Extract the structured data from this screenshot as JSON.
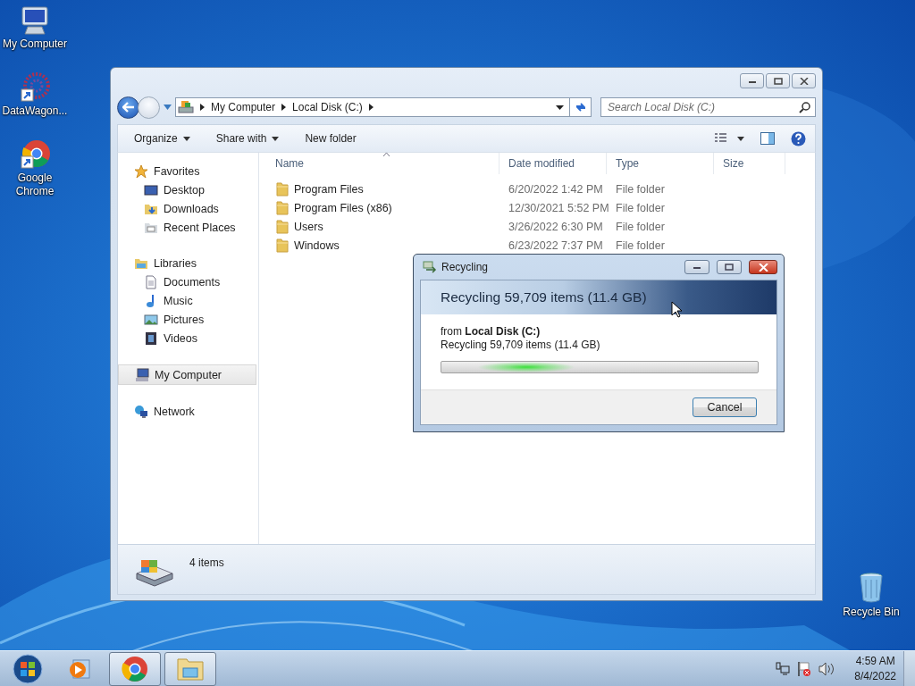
{
  "desktop_icons": [
    {
      "label": "My Computer",
      "kind": "computer"
    },
    {
      "label": "DataWagon...",
      "kind": "app"
    },
    {
      "label": "Google Chrome",
      "kind": "chrome"
    },
    {
      "label": "Recycle Bin",
      "kind": "bin"
    }
  ],
  "explorer": {
    "breadcrumb": [
      "My Computer",
      "Local Disk (C:)"
    ],
    "search": {
      "placeholder": "Search Local Disk (C:)"
    },
    "toolbar": [
      {
        "label": "Organize",
        "menu": true
      },
      {
        "label": "Share with",
        "menu": true
      },
      {
        "label": "New folder",
        "menu": false
      }
    ],
    "sidebar": [
      {
        "label": "Favorites",
        "kind": "star",
        "selected": false,
        "children": [
          {
            "label": "Desktop",
            "kind": "desktop",
            "selected": false
          },
          {
            "label": "Downloads",
            "kind": "downloads",
            "selected": false
          },
          {
            "label": "Recent Places",
            "kind": "recent",
            "selected": false
          }
        ]
      },
      {
        "label": "Libraries",
        "kind": "library",
        "selected": false,
        "children": [
          {
            "label": "Documents",
            "kind": "document",
            "selected": false
          },
          {
            "label": "Music",
            "kind": "music",
            "selected": false
          },
          {
            "label": "Pictures",
            "kind": "pictures",
            "selected": false
          },
          {
            "label": "Videos",
            "kind": "videos",
            "selected": false
          }
        ]
      },
      {
        "label": "My Computer",
        "kind": "computer",
        "selected": true
      },
      {
        "label": "Network",
        "kind": "network",
        "selected": false
      }
    ],
    "columns": [
      "Name",
      "Date modified",
      "Type",
      "Size"
    ],
    "rows": [
      {
        "name": "Program Files",
        "date": "6/20/2022 1:42 PM",
        "type": "File folder"
      },
      {
        "name": "Program Files (x86)",
        "date": "12/30/2021 5:52 PM",
        "type": "File folder"
      },
      {
        "name": "Users",
        "date": "3/26/2022 6:30 PM",
        "type": "File folder"
      },
      {
        "name": "Windows",
        "date": "6/23/2022 7:37 PM",
        "type": "File folder"
      }
    ],
    "status": "4 items"
  },
  "dialog": {
    "title": "Recycling",
    "heading": "Recycling 59,709 items (11.4 GB)",
    "from": "from **Local Disk (C:)**",
    "detail": "Recycling 59,709 items (11.4 GB)",
    "progress": {
      "kind": "marquee"
    },
    "buttons": [
      "Cancel"
    ]
  },
  "taskbar": {
    "items": [
      {
        "kind": "media",
        "running": false
      },
      {
        "kind": "chrome",
        "running": true
      },
      {
        "kind": "explorer",
        "running": true
      }
    ],
    "time": "4:59 AM",
    "date": "8/4/2022"
  }
}
